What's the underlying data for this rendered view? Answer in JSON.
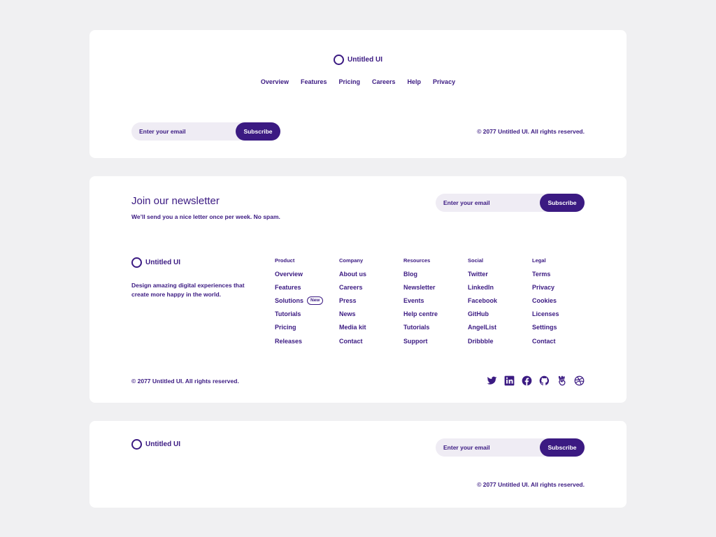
{
  "brand": {
    "name": "Untitled UI"
  },
  "footer1": {
    "nav": [
      "Overview",
      "Features",
      "Pricing",
      "Careers",
      "Help",
      "Privacy"
    ],
    "email_placeholder": "Enter your email",
    "subscribe_label": "Subscribe",
    "copyright": "© 2077 Untitled UI. All rights reserved."
  },
  "footer2": {
    "heading": "Join our newsletter",
    "subheading": "We’ll send you a nice letter once per week. No spam.",
    "email_placeholder": "Enter your email",
    "subscribe_label": "Subscribe",
    "tagline": "Design amazing digital experiences that create more happy in the world.",
    "columns": [
      {
        "title": "Product",
        "links": [
          "Overview",
          "Features",
          "Solutions",
          "Tutorials",
          "Pricing",
          "Releases"
        ],
        "badge": "New"
      },
      {
        "title": "Company",
        "links": [
          "About us",
          "Careers",
          "Press",
          "News",
          "Media kit",
          "Contact"
        ]
      },
      {
        "title": "Resources",
        "links": [
          "Blog",
          "Newsletter",
          "Events",
          "Help centre",
          "Tutorials",
          "Support"
        ]
      },
      {
        "title": "Social",
        "links": [
          "Twitter",
          "LinkedIn",
          "Facebook",
          "GitHub",
          "AngelList",
          "Dribbble"
        ]
      },
      {
        "title": "Legal",
        "links": [
          "Terms",
          "Privacy",
          "Cookies",
          "Licenses",
          "Settings",
          "Contact"
        ]
      }
    ],
    "copyright": "© 2077 Untitled UI. All rights reserved.",
    "social_icons": [
      "twitter-icon",
      "linkedin-icon",
      "facebook-icon",
      "github-icon",
      "angellist-icon",
      "dribbble-icon"
    ]
  },
  "footer3": {
    "email_placeholder": "Enter your email",
    "subscribe_label": "Subscribe",
    "copyright": "© 2077 Untitled UI. All rights reserved."
  },
  "colors": {
    "accent": "#3b1a82",
    "background": "#f0f0f2",
    "card": "#ffffff",
    "input_bg": "#efecf4"
  }
}
